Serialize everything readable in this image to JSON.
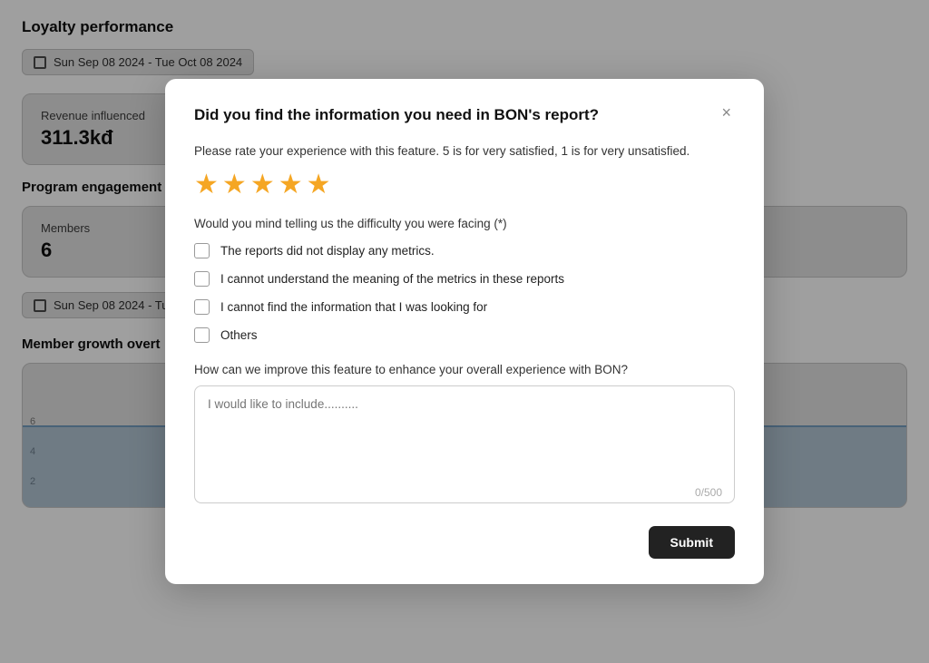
{
  "background": {
    "page_title": "Loyalty performance",
    "date_range": "Sun Sep 08 2024 - Tue Oct 08 2024",
    "revenue_label": "Revenue influenced",
    "revenue_value": "311.3kđ",
    "program_engagement_title": "Program engagement",
    "members_label": "Members",
    "members_value": "6",
    "date_range2": "Sun Sep 08 2024 - Tu",
    "member_growth_title": "Member growth overt",
    "chart_y1": "6",
    "chart_y2": "4",
    "chart_y3": "2"
  },
  "modal": {
    "title": "Did you find the information you need in BON's report?",
    "close_label": "×",
    "rating_instruction": "Please rate your experience with this feature. 5 is for very satisfied, 1 is for very unsatisfied.",
    "stars": [
      "★",
      "★",
      "★",
      "★",
      "★"
    ],
    "difficulty_label": "Would you mind telling us the difficulty you were facing (*)",
    "checkboxes": [
      {
        "id": "cb1",
        "label": "The reports did not display any metrics."
      },
      {
        "id": "cb2",
        "label": "I cannot understand the meaning of the metrics in these reports"
      },
      {
        "id": "cb3",
        "label": "I cannot find the information that I was looking for"
      },
      {
        "id": "cb4",
        "label": "Others"
      }
    ],
    "improve_label": "How can we improve this feature to enhance your overall experience with BON?",
    "textarea_placeholder": "I would like to include..........",
    "char_count": "0/500",
    "submit_label": "Submit"
  }
}
